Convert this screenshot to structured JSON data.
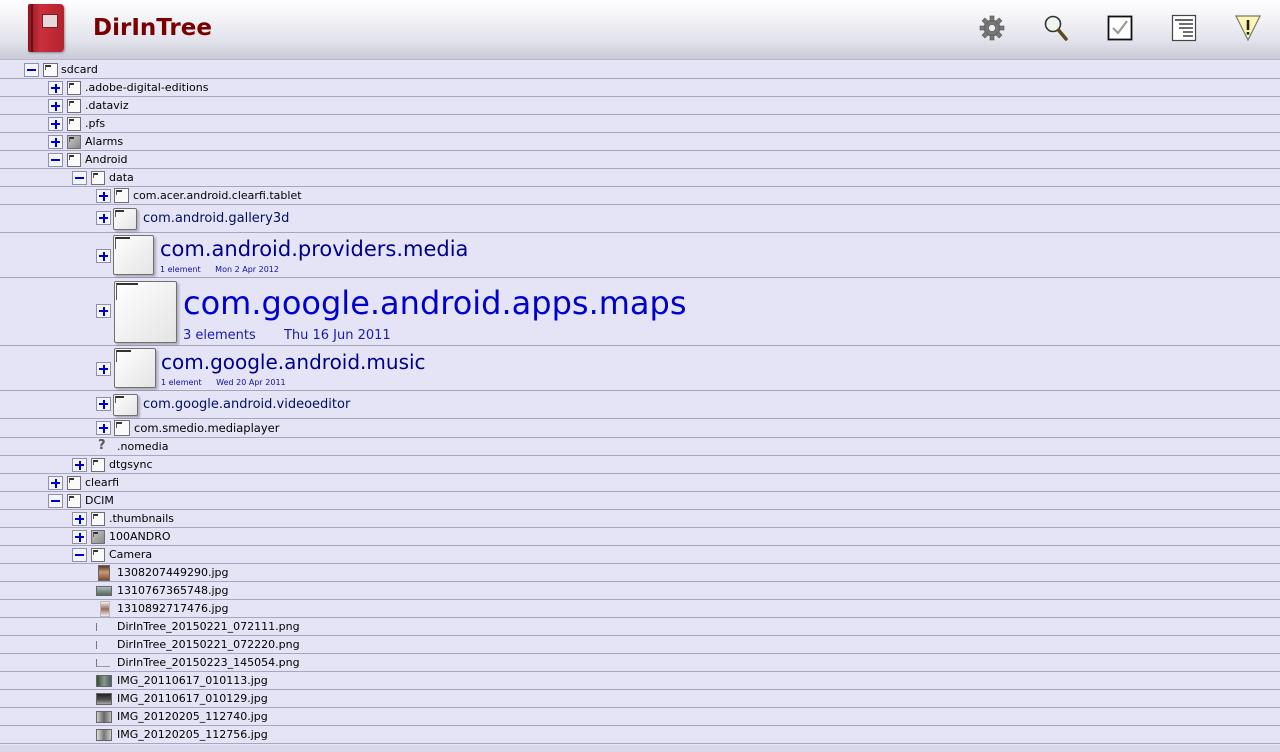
{
  "app": {
    "title": "DirInTree"
  },
  "toolbar": [
    {
      "name": "settings-gear-icon"
    },
    {
      "name": "search-icon"
    },
    {
      "name": "select-checkbox-icon"
    },
    {
      "name": "list-view-icon"
    },
    {
      "name": "warning-icon"
    }
  ],
  "tree": [
    {
      "label": "sdcard",
      "depth": 0,
      "toggle": "minus",
      "icon": "sdcard-icon"
    },
    {
      "label": ".adobe-digital-editions",
      "depth": 1,
      "toggle": "plus",
      "icon": "folder-icon"
    },
    {
      "label": ".dataviz",
      "depth": 1,
      "toggle": "plus",
      "icon": "folder-icon"
    },
    {
      "label": ".pfs",
      "depth": 1,
      "toggle": "plus",
      "icon": "folder-icon"
    },
    {
      "label": "Alarms",
      "depth": 1,
      "toggle": "plus",
      "icon": "folder-gray-icon"
    },
    {
      "label": "Android",
      "depth": 1,
      "toggle": "minus",
      "icon": "folder-icon"
    },
    {
      "label": "data",
      "depth": 2,
      "toggle": "minus",
      "icon": "folder-icon"
    },
    {
      "label": "com.acer.android.clearfi.tablet",
      "depth": 3,
      "toggle": "plus",
      "icon": "folder-icon"
    },
    {
      "label": "com.android.gallery3d",
      "depth": 3,
      "toggle": "plus",
      "icon": "folder-icon"
    },
    {
      "label": "com.android.providers.media",
      "depth": 3,
      "toggle": "plus",
      "icon": "folder-icon",
      "elements": "1 element",
      "date": "Mon 2 Apr 2012"
    },
    {
      "label": "com.google.android.apps.maps",
      "depth": 3,
      "toggle": "plus",
      "icon": "folder-icon",
      "elements": "3 elements",
      "date": "Thu 16 Jun 2011"
    },
    {
      "label": "com.google.android.music",
      "depth": 3,
      "toggle": "plus",
      "icon": "folder-icon",
      "elements": "1 element",
      "date": "Wed 20 Apr 2011"
    },
    {
      "label": "com.google.android.videoeditor",
      "depth": 3,
      "toggle": "plus",
      "icon": "folder-icon"
    },
    {
      "label": "com.smedio.mediaplayer",
      "depth": 3,
      "toggle": "plus",
      "icon": "folder-icon"
    },
    {
      "label": ".nomedia",
      "depth": 3,
      "toggle": "none",
      "icon": "unknown-file-icon"
    },
    {
      "label": "dtgsync",
      "depth": 2,
      "toggle": "plus",
      "icon": "folder-icon"
    },
    {
      "label": "clearfi",
      "depth": 1,
      "toggle": "plus",
      "icon": "folder-icon"
    },
    {
      "label": "DCIM",
      "depth": 1,
      "toggle": "minus",
      "icon": "folder-icon"
    },
    {
      "label": ".thumbnails",
      "depth": 2,
      "toggle": "plus",
      "icon": "folder-icon"
    },
    {
      "label": "100ANDRO",
      "depth": 2,
      "toggle": "plus",
      "icon": "folder-gray-icon"
    },
    {
      "label": "Camera",
      "depth": 2,
      "toggle": "minus",
      "icon": "folder-icon"
    },
    {
      "label": "1308207449290.jpg",
      "depth": 3,
      "toggle": "none",
      "icon": "image-thumbnail-icon"
    },
    {
      "label": "1310767365748.jpg",
      "depth": 3,
      "toggle": "none",
      "icon": "image-thumbnail-icon"
    },
    {
      "label": "1310892717476.jpg",
      "depth": 3,
      "toggle": "none",
      "icon": "image-thumbnail-icon"
    },
    {
      "label": "DirInTree_20150221_072111.png",
      "depth": 3,
      "toggle": "none",
      "icon": "image-thumbnail-icon"
    },
    {
      "label": "DirInTree_20150221_072220.png",
      "depth": 3,
      "toggle": "none",
      "icon": "image-thumbnail-icon"
    },
    {
      "label": "DirInTree_20150223_145054.png",
      "depth": 3,
      "toggle": "none",
      "icon": "image-thumbnail-icon"
    },
    {
      "label": "IMG_20110617_010113.jpg",
      "depth": 3,
      "toggle": "none",
      "icon": "image-thumbnail-icon"
    },
    {
      "label": "IMG_20110617_010129.jpg",
      "depth": 3,
      "toggle": "none",
      "icon": "image-thumbnail-icon"
    },
    {
      "label": "IMG_20120205_112740.jpg",
      "depth": 3,
      "toggle": "none",
      "icon": "image-thumbnail-icon"
    },
    {
      "label": "IMG_20120205_112756.jpg",
      "depth": 3,
      "toggle": "none",
      "icon": "image-thumbnail-icon"
    }
  ],
  "colors": {
    "row_bg": "#e4e4f6",
    "title": "#7a0000",
    "meta": "#1010a0",
    "toggle": "#0000cc"
  }
}
